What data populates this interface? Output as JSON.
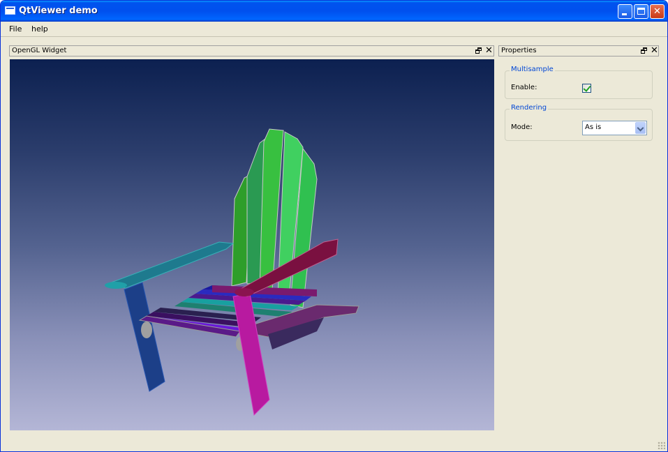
{
  "window": {
    "title": "QtViewer demo"
  },
  "menu": {
    "items": [
      "File",
      "help"
    ]
  },
  "gl_dock": {
    "title": "OpenGL Widget"
  },
  "properties_dock": {
    "title": "Properties",
    "multisample": {
      "group_title": "Multisample",
      "enable_label": "Enable:",
      "enabled": true
    },
    "rendering": {
      "group_title": "Rendering",
      "mode_label": "Mode:",
      "mode_value": "As is"
    }
  },
  "colors": {
    "title_bar": "#0054e3",
    "group_title": "#0046d5",
    "window_bg": "#ece9d8"
  }
}
